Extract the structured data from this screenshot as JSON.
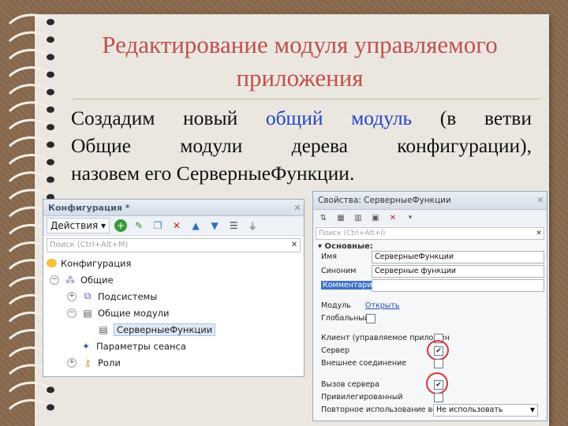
{
  "slide": {
    "title": "Редактирование модуля управляемого приложения",
    "text_l1_a": "Создадим",
    "text_l1_b": "новый",
    "text_l1_c": "общий",
    "text_l1_d": "модуль",
    "text_l1_e": "(в",
    "text_l1_f": "ветви",
    "text_l2_a": "Общие",
    "text_l2_b": "модули",
    "text_l2_c": "дерева",
    "text_l2_d": "конфигурации),",
    "text_l3": "назовем его СерверныеФункции."
  },
  "config_window": {
    "title": "Конфигурация *",
    "actions_label": "Действия",
    "search_placeholder": "Поиск (Ctrl+Alt+M)",
    "tree": [
      {
        "label": "Конфигурация"
      },
      {
        "label": "Общие"
      },
      {
        "label": "Подсистемы"
      },
      {
        "label": "Общие модули"
      },
      {
        "label": "СерверныеФункции"
      },
      {
        "label": "Параметры сеанса"
      },
      {
        "label": "Роли"
      }
    ]
  },
  "props_window": {
    "title": "Свойства: СерверныеФункции",
    "search_placeholder": "Поиск (Ctrl+Alt+I)",
    "group": "Основные:",
    "name_label": "Имя",
    "name_value": "СерверныеФункции",
    "synonym_label": "Синоним",
    "synonym_value": "Серверные функции",
    "comment_label": "Комментарий",
    "module_label": "Модуль",
    "module_link": "Открыть",
    "global_label": "Глобальный",
    "client_label": "Клиент (управляемое приложен",
    "server_label": "Сервер",
    "external_label": "Внешнее соединение",
    "server_call_label": "Вызов сервера",
    "privileged_label": "Привилегированный",
    "reuse_label": "Повторное использование возв",
    "reuse_value": "Не использовать",
    "checks": {
      "global": false,
      "client": false,
      "server": true,
      "external": false,
      "server_call": true,
      "privileged": false
    }
  },
  "colors": {
    "title": "#c0504d",
    "highlight": "#2446c4",
    "annotation": "#d33333"
  }
}
